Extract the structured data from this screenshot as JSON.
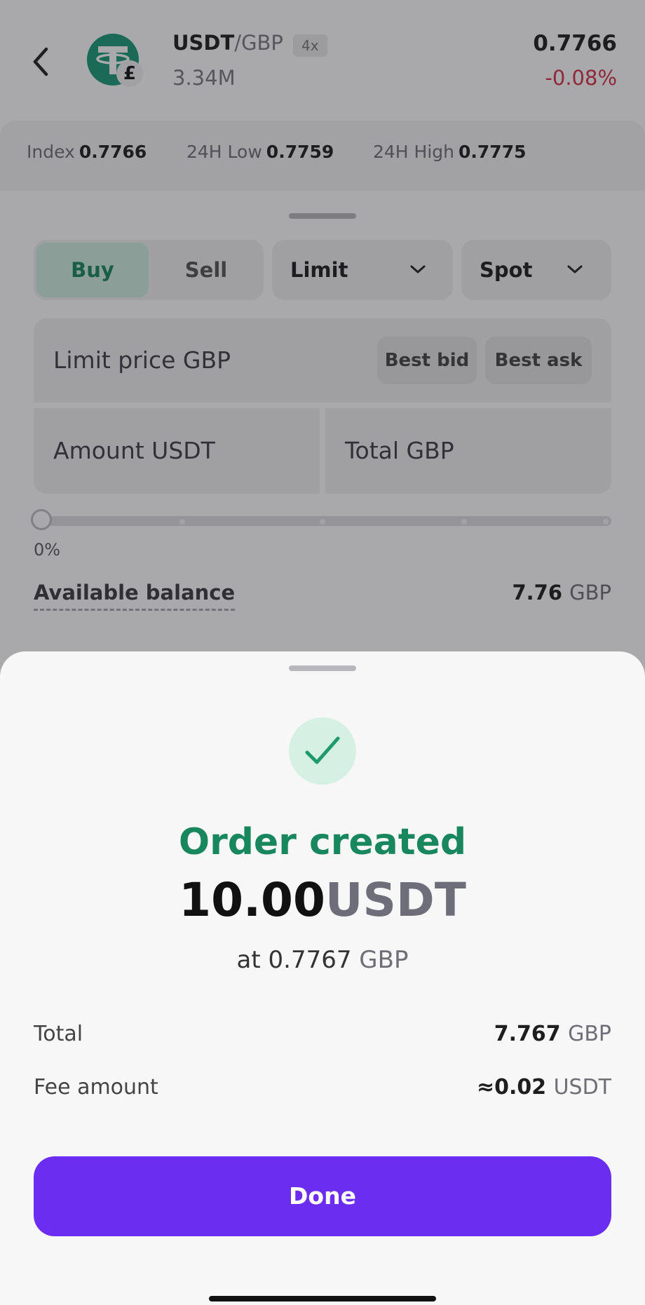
{
  "header": {
    "pair_base": "USDT",
    "pair_quote": "/GBP",
    "leverage": "4x",
    "volume": "3.34M",
    "price": "0.7766",
    "change": "-0.08%",
    "coin_badge": "£"
  },
  "stats": {
    "index_label": "Index",
    "index_value": "0.7766",
    "low_label": "24H Low",
    "low_value": "0.7759",
    "high_label": "24H High",
    "high_value": "0.7775"
  },
  "order_form": {
    "buy_label": "Buy",
    "sell_label": "Sell",
    "order_type": "Limit",
    "account_type": "Spot",
    "limit_price_label": "Limit price GBP",
    "best_bid_label": "Best bid",
    "best_ask_label": "Best ask",
    "amount_label": "Amount USDT",
    "total_label": "Total GBP",
    "slider_percent": "0%",
    "slider_value": 0,
    "available_label": "Available balance",
    "available_amount": "7.76",
    "available_currency": "GBP"
  },
  "sheet": {
    "title": "Order created",
    "amount": "10.00",
    "amount_unit": "USDT",
    "at_prefix": "at",
    "at_price": "0.7767",
    "at_currency": "GBP",
    "rows": [
      {
        "label": "Total",
        "value": "7.767",
        "currency": "GBP"
      },
      {
        "label": "Fee amount",
        "value": "≈0.02",
        "currency": "USDT"
      }
    ],
    "done_label": "Done"
  },
  "colors": {
    "accent_green": "#19875e",
    "negative_red": "#d32f4a",
    "button_purple": "#6b2ef0"
  },
  "icons": [
    "back-chevron-icon",
    "tether-icon",
    "chevron-down-icon",
    "check-icon"
  ]
}
